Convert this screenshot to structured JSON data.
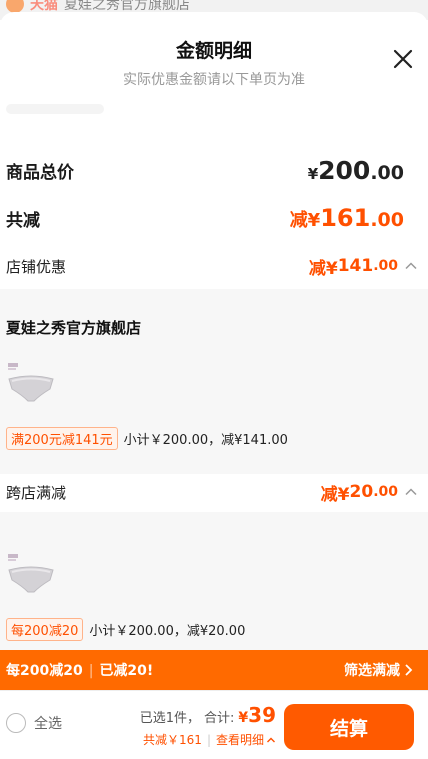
{
  "peek": {
    "tag": "天猫",
    "text": "夏娃之秀官方旗舰店"
  },
  "header": {
    "title": "金额明细",
    "subtitle": "实际优惠金额请以下单页为准"
  },
  "total": {
    "label": "商品总价",
    "currency": "¥",
    "integer": "200",
    "decimal": ".00"
  },
  "reduce": {
    "label": "共减",
    "prefix": "减¥",
    "integer": "161",
    "decimal": ".00"
  },
  "store_section": {
    "label": "店铺优惠",
    "prefix": "减¥",
    "integer": "141",
    "decimal": ".00",
    "store_name": "夏娃之秀官方旗舰店",
    "promo_tag": "满200元减141元",
    "promo_text": "小计￥200.00，减¥141.00"
  },
  "cross_section": {
    "label": "跨店满减",
    "prefix": "减¥",
    "integer": "20",
    "decimal": ".00",
    "promo_tag": "每200减20",
    "promo_text": "小计￥200.00，减¥20.00"
  },
  "banner": {
    "left1": "每200减20",
    "sep": "|",
    "left2": "已减20!",
    "right": "筛选满减"
  },
  "footer": {
    "select_all": "全选",
    "selected": "已选1件，",
    "total_label": "合计:",
    "total_currency": "¥",
    "total_value": "39",
    "reduced": "共减￥161",
    "divider": "|",
    "detail": "查看明细",
    "checkout": "结算"
  },
  "colors": {
    "accent": "#ff5000",
    "banner": "#ff6a00",
    "checkout": "#ff5a00"
  }
}
